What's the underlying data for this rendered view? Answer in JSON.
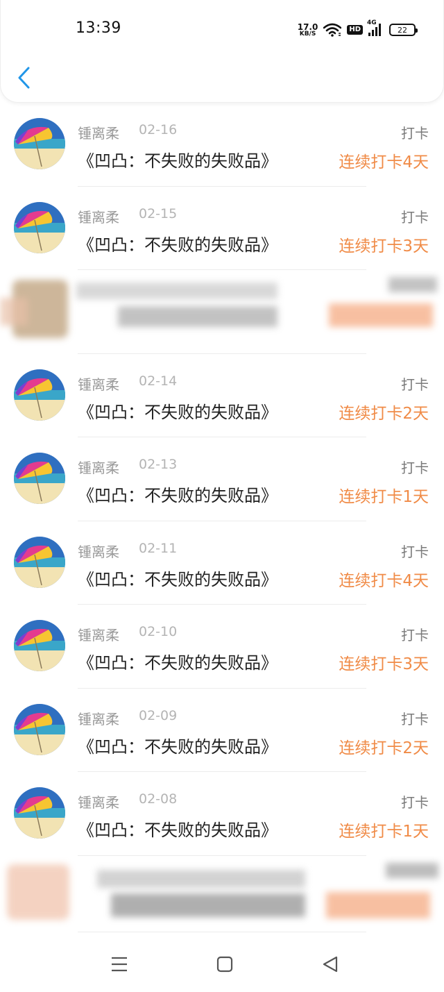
{
  "status_bar": {
    "time": "13:39",
    "net_speed_value": "17.0",
    "net_speed_unit": "KB/S",
    "hd_label": "HD",
    "network_label": "4G",
    "battery_level": "22"
  },
  "header": {
    "back_icon": "chevron-left-icon"
  },
  "colors": {
    "accent": "#2196e8",
    "streak": "#f08b47",
    "muted": "#9a9a9a"
  },
  "entries": [
    {
      "name": "锺离柔",
      "date": "02-16",
      "action": "打卡",
      "title": "《凹凸：不失败的失败品》",
      "streak": "连续打卡4天"
    },
    {
      "name": "锺离柔",
      "date": "02-15",
      "action": "打卡",
      "title": "《凹凸：不失败的失败品》",
      "streak": "连续打卡3天"
    },
    {
      "name": "锺离柔",
      "date": "02-14",
      "action": "打卡",
      "title": "《凹凸：不失败的失败品》",
      "streak": "连续打卡2天"
    },
    {
      "name": "锺离柔",
      "date": "02-13",
      "action": "打卡",
      "title": "《凹凸：不失败的失败品》",
      "streak": "连续打卡1天"
    },
    {
      "name": "锺离柔",
      "date": "02-11",
      "action": "打卡",
      "title": "《凹凸：不失败的失败品》",
      "streak": "连续打卡4天"
    },
    {
      "name": "锺离柔",
      "date": "02-10",
      "action": "打卡",
      "title": "《凹凸：不失败的失败品》",
      "streak": "连续打卡3天"
    },
    {
      "name": "锺离柔",
      "date": "02-09",
      "action": "打卡",
      "title": "《凹凸：不失败的失败品》",
      "streak": "连续打卡2天"
    },
    {
      "name": "锺离柔",
      "date": "02-08",
      "action": "打卡",
      "title": "《凹凸：不失败的失败品》",
      "streak": "连续打卡1天"
    }
  ],
  "nav": {
    "menu_icon": "menu-icon",
    "home_icon": "home-square-icon",
    "back_icon": "back-triangle-icon"
  }
}
